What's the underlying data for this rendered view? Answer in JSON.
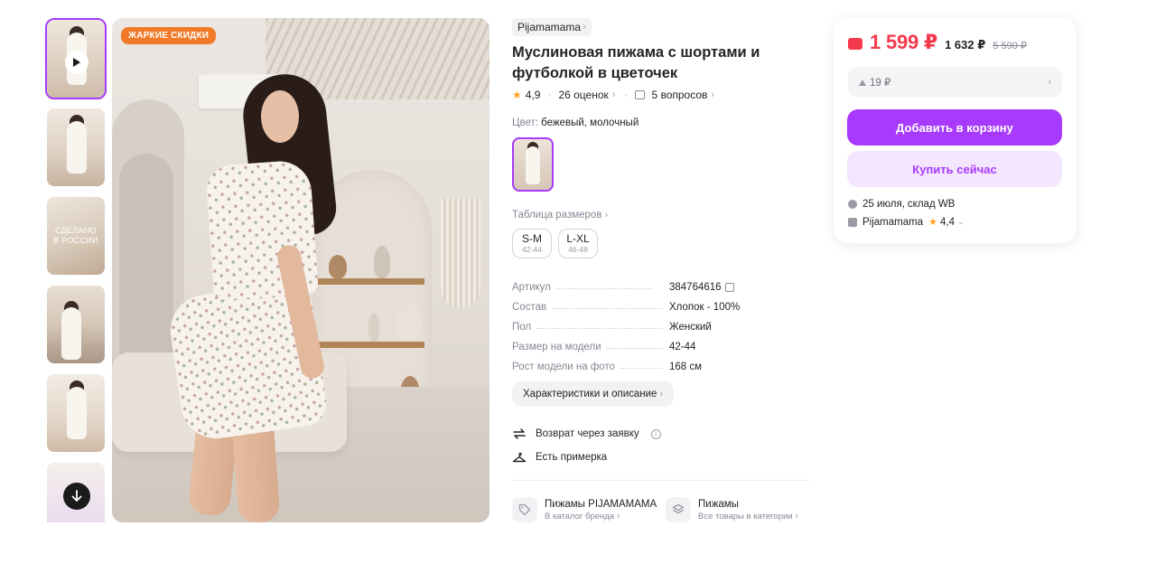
{
  "gallery": {
    "badge": "ЖАРКИЕ СКИДКИ",
    "thumb3_text": "СДЕЛАНО В РОССИИ"
  },
  "product": {
    "brand": "Pijamamama",
    "title": "Муслиновая пижама с шортами и футболкой в цветочек",
    "rating": "4,9",
    "reviews": "26 оценок",
    "questions": "5 вопросов",
    "color_label": "Цвет:",
    "color_value": "бежевый, молочный",
    "size_table_link": "Таблица размеров",
    "sizes": [
      {
        "size": "S-M",
        "ru": "42-44"
      },
      {
        "size": "L-XL",
        "ru": "46-48"
      }
    ],
    "specs": [
      {
        "key": "Артикул",
        "value": "384764616"
      },
      {
        "key": "Состав",
        "value": "Хлопок - 100%"
      },
      {
        "key": "Пол",
        "value": "Женский"
      },
      {
        "key": "Размер на модели",
        "value": "42-44"
      },
      {
        "key": "Рост модели на фото",
        "value": "168 см"
      }
    ],
    "characteristics_button": "Характеристики и описание",
    "features": [
      {
        "label": "Возврат через заявку",
        "icon": "return-arrows-icon"
      },
      {
        "label": "Есть примерка",
        "icon": "hanger-icon"
      }
    ],
    "links": [
      {
        "title": "Пижамы PIJAMAMAMA",
        "sub": "В каталог бренда",
        "icon": "tag-icon"
      },
      {
        "title": "Пижамы",
        "sub": "Все товары в категории",
        "icon": "stack-icon"
      }
    ]
  },
  "buy": {
    "price": "1 599 ₽",
    "price_card": "1 632 ₽",
    "price_old": "5 590 ₽",
    "bonus": "19 ₽",
    "add_to_cart": "Добавить в корзину",
    "buy_now": "Купить сейчас",
    "delivery_date": "25 июля,",
    "delivery_place": "склад WB",
    "seller": "Pijamamama",
    "seller_rating": "4,4"
  },
  "colors": {
    "accent": "#a73afd",
    "price": "#f5394c",
    "badge": "#f07a28",
    "star": "#ffa41f"
  }
}
